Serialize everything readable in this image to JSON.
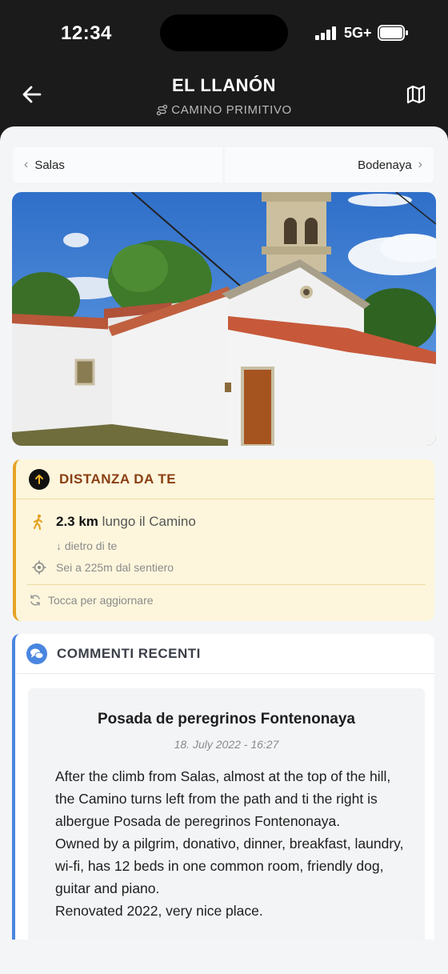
{
  "status_bar": {
    "time": "12:34",
    "network": "5G+"
  },
  "nav": {
    "title": "EL LLANÓN",
    "subtitle": "CAMINO PRIMITIVO"
  },
  "stage_nav": {
    "prev": "Salas",
    "next": "Bodenaya"
  },
  "distance": {
    "title": "DISTANZA DA TE",
    "value": "2.3 km",
    "along": "lungo il Camino",
    "direction": "↓ dietro di te",
    "offtrail": "Sei a 225m dal sentiero",
    "refresh": "Tocca per aggiornare"
  },
  "comments": {
    "title": "COMMENTI RECENTI",
    "items": [
      {
        "title": "Posada de peregrinos Fontenonaya",
        "date": "18. July 2022 - 16:27",
        "p1": "After the climb from Salas, almost at the top of the hill, the Camino turns left from the path and ti the right is albergue Posada de peregrinos Fontenonaya.",
        "p2": "Owned by a pilgrim, donativo, dinner, breakfast, laundry, wi-fi, has 12 beds in one common room, friendly dog, guitar and piano.",
        "p3": "Renovated 2022, very nice place."
      }
    ]
  },
  "colors": {
    "header_bg": "#1b1b1b",
    "distance_accent": "#e6a323",
    "distance_title": "#8a3f12",
    "comments_accent": "#4a86e0"
  }
}
